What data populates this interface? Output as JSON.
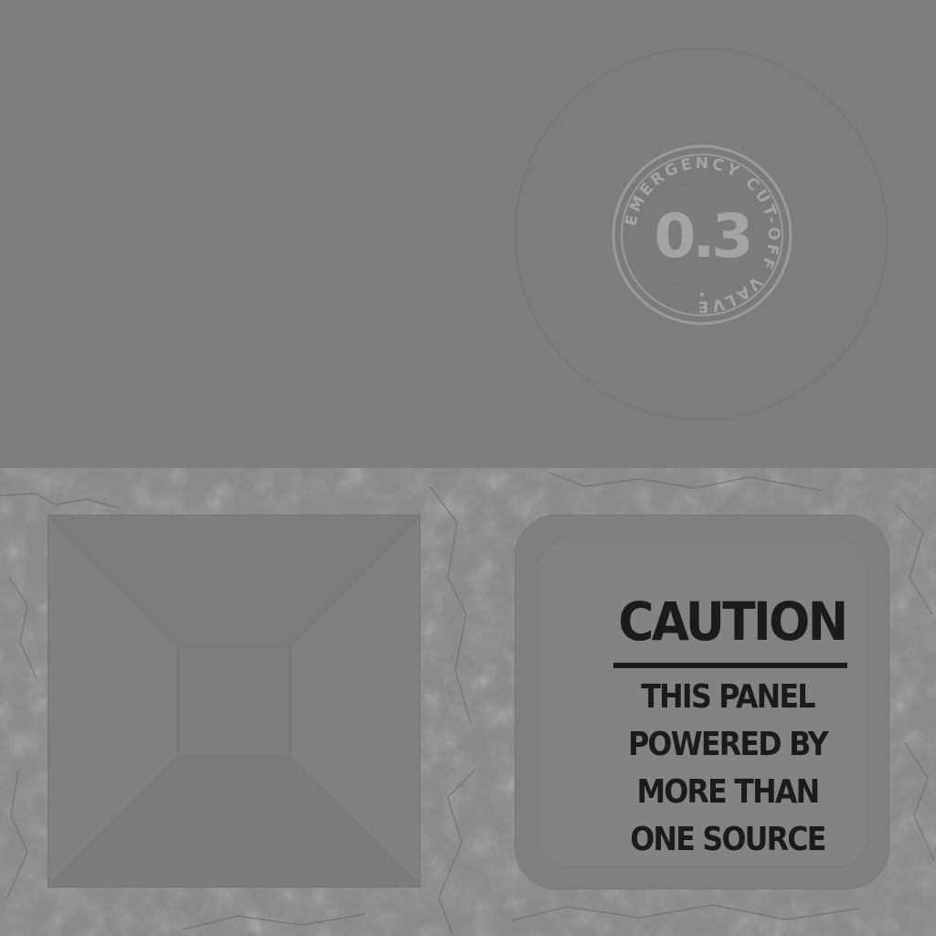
{
  "valve_badge": {
    "ring_text": "EMERGENCY CUT-OFF VALVE",
    "separator": "•",
    "value": "0.3"
  },
  "caution_sign": {
    "title": "CAUTION",
    "lines": [
      "THIS PANEL",
      "POWERED BY",
      "MORE THAN",
      "ONE SOURCE"
    ]
  },
  "colors": {
    "top_background": "#7e7e7e",
    "bottom_background": "#8a8a8a",
    "sign_text": "#1b1b1b",
    "badge_text": "#a4a4a4"
  },
  "icons": {
    "valve": "valve-badge-icon",
    "bevel": "bevel-square-icon"
  }
}
